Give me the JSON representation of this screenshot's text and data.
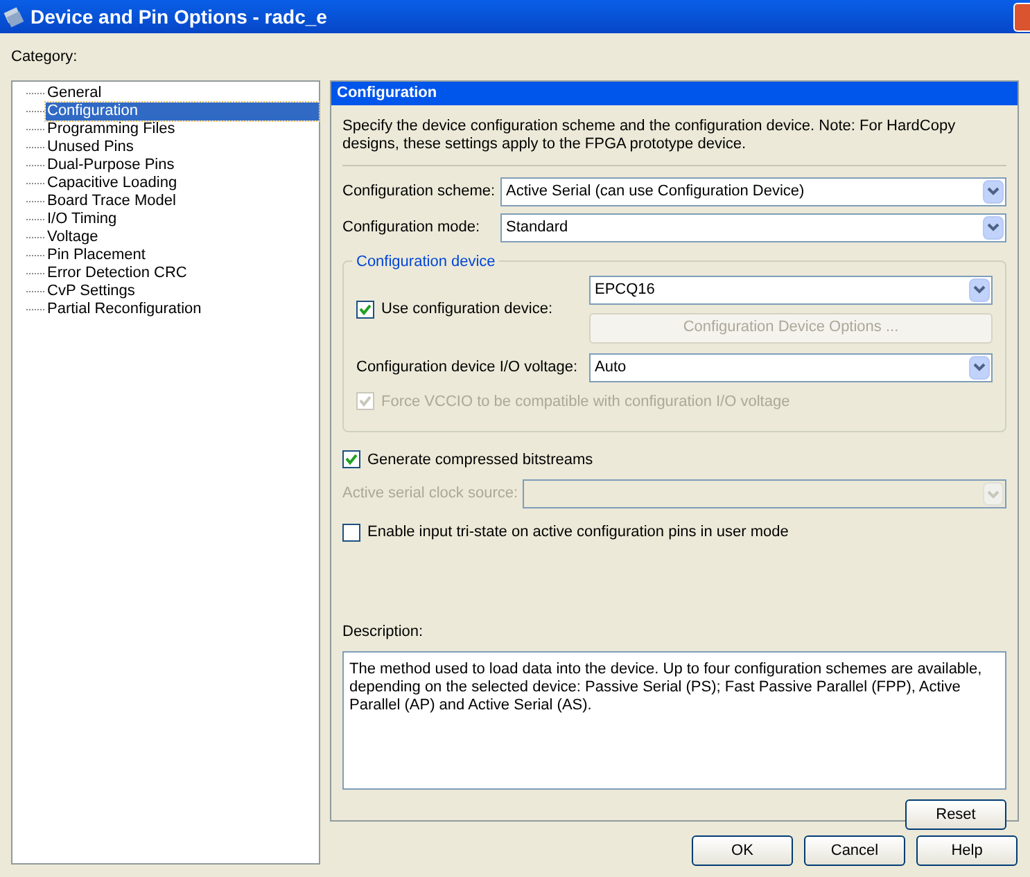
{
  "window": {
    "title": "Device and Pin Options - radc_e"
  },
  "category_label": "Category:",
  "tree": {
    "items": [
      {
        "label": "General",
        "selected": false
      },
      {
        "label": "Configuration",
        "selected": true
      },
      {
        "label": "Programming Files",
        "selected": false
      },
      {
        "label": "Unused Pins",
        "selected": false
      },
      {
        "label": "Dual-Purpose Pins",
        "selected": false
      },
      {
        "label": "Capacitive Loading",
        "selected": false
      },
      {
        "label": "Board Trace Model",
        "selected": false
      },
      {
        "label": "I/O Timing",
        "selected": false
      },
      {
        "label": "Voltage",
        "selected": false
      },
      {
        "label": "Pin Placement",
        "selected": false
      },
      {
        "label": "Error Detection CRC",
        "selected": false
      },
      {
        "label": "CvP Settings",
        "selected": false
      },
      {
        "label": "Partial Reconfiguration",
        "selected": false
      }
    ]
  },
  "panel": {
    "title": "Configuration",
    "intro": "Specify the device configuration scheme and the configuration device. Note: For HardCopy designs, these settings apply to the FPGA prototype device.",
    "scheme": {
      "label": "Configuration scheme:",
      "value": "Active Serial (can use Configuration Device)"
    },
    "mode": {
      "label": "Configuration mode:",
      "value": "Standard"
    },
    "device_group": {
      "title": "Configuration device",
      "use_device": {
        "label": "Use configuration device:",
        "checked": true,
        "disabled": false
      },
      "device": {
        "value": "EPCQ16"
      },
      "options_button": {
        "label": "Configuration Device Options ...",
        "disabled": true
      },
      "io_voltage": {
        "label": "Configuration device I/O voltage:",
        "value": "Auto"
      },
      "force_vccio": {
        "label": "Force VCCIO to be compatible with configuration I/O voltage",
        "checked": true,
        "disabled": true
      }
    },
    "compressed": {
      "label": "Generate compressed bitstreams",
      "checked": true,
      "disabled": false
    },
    "clock_source": {
      "label": "Active serial clock source:",
      "disabled": true
    },
    "tristate": {
      "label": "Enable input tri-state on active configuration pins in user mode",
      "checked": false,
      "disabled": false
    },
    "description_label": "Description:",
    "description": "The method used to load data into the device. Up to four configuration schemes are available, depending on the selected device: Passive Serial (PS); Fast Passive Parallel (FPP), Active Parallel (AP) and Active Serial (AS).",
    "reset": "Reset"
  },
  "buttons": [
    "OK",
    "Cancel",
    "Help"
  ]
}
